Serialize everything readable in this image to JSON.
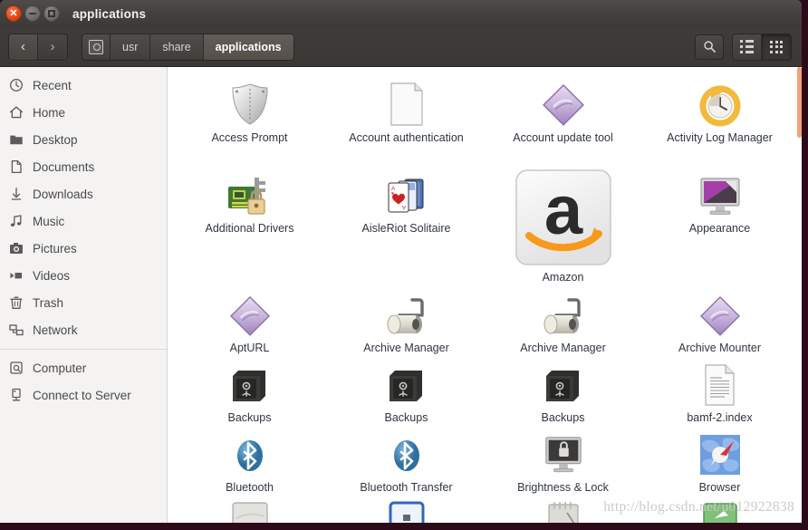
{
  "window": {
    "title": "applications",
    "controls": {
      "close": "close-button",
      "minimize": "minimize-button",
      "maximize": "maximize-button"
    }
  },
  "toolbar": {
    "back_label": "‹",
    "forward_label": "›",
    "search_label": "Search",
    "view_list_label": "List view",
    "view_grid_label": "Icon view",
    "active_view": "grid"
  },
  "breadcrumb": {
    "root_icon": "computer-disk-icon",
    "items": [
      {
        "label": "usr",
        "active": false
      },
      {
        "label": "share",
        "active": false
      },
      {
        "label": "applications",
        "active": true
      }
    ]
  },
  "sidebar": {
    "items": [
      {
        "label": "Recent",
        "icon": "clock-icon"
      },
      {
        "label": "Home",
        "icon": "home-icon"
      },
      {
        "label": "Desktop",
        "icon": "folder-icon"
      },
      {
        "label": "Documents",
        "icon": "document-icon"
      },
      {
        "label": "Downloads",
        "icon": "download-icon"
      },
      {
        "label": "Music",
        "icon": "music-note-icon"
      },
      {
        "label": "Pictures",
        "icon": "camera-icon"
      },
      {
        "label": "Videos",
        "icon": "video-icon"
      },
      {
        "label": "Trash",
        "icon": "trash-icon"
      },
      {
        "label": "Network",
        "icon": "network-icon"
      }
    ],
    "devices": [
      {
        "label": "Computer",
        "icon": "computer-icon"
      },
      {
        "label": "Connect to Server",
        "icon": "server-icon"
      }
    ]
  },
  "files": [
    {
      "name": "Access Prompt",
      "icon": "shield-icon",
      "selected": false
    },
    {
      "name": "Account authentication",
      "icon": "blank-document-icon",
      "selected": false
    },
    {
      "name": "Account update tool",
      "icon": "purple-diamond-icon",
      "selected": false
    },
    {
      "name": "Activity Log Manager",
      "icon": "clock-restore-icon",
      "selected": false
    },
    {
      "name": "Additional Drivers",
      "icon": "circuit-lock-icon",
      "selected": false
    },
    {
      "name": "AisleRiot Solitaire",
      "icon": "playing-cards-icon",
      "selected": false
    },
    {
      "name": "Amazon",
      "icon": "amazon-icon",
      "selected": true
    },
    {
      "name": "Appearance",
      "icon": "monitor-purple-icon",
      "selected": false
    },
    {
      "name": "AptURL",
      "icon": "purple-diamond-icon",
      "selected": false
    },
    {
      "name": "Archive Manager",
      "icon": "file-roller-icon",
      "selected": false
    },
    {
      "name": "Archive Manager",
      "icon": "file-roller-icon",
      "selected": false
    },
    {
      "name": "Archive Mounter",
      "icon": "purple-diamond-icon",
      "selected": false
    },
    {
      "name": "Backups",
      "icon": "safe-vault-icon",
      "selected": false
    },
    {
      "name": "Backups",
      "icon": "safe-vault-icon",
      "selected": false
    },
    {
      "name": "Backups",
      "icon": "safe-vault-icon",
      "selected": false
    },
    {
      "name": "bamf-2.index",
      "icon": "text-document-icon",
      "selected": false
    },
    {
      "name": "Bluetooth",
      "icon": "bluetooth-icon",
      "selected": false
    },
    {
      "name": "Bluetooth Transfer",
      "icon": "bluetooth-icon",
      "selected": false
    },
    {
      "name": "Brightness & Lock",
      "icon": "monitor-lock-icon",
      "selected": false
    },
    {
      "name": "Browser",
      "icon": "compass-globe-icon",
      "selected": false
    }
  ],
  "watermark": {
    "text": "http://blog.csdn.net/u012922838"
  },
  "colors": {
    "titlebar": "#434140",
    "toolbar": "#3a3735",
    "accent_close": "#dd4814",
    "scrollbar": "#f4a175",
    "desktop": "#2d0a18",
    "sidebar_bg": "#f4f3f2",
    "content_bg": "#ffffff",
    "label_text": "#2f3640"
  }
}
